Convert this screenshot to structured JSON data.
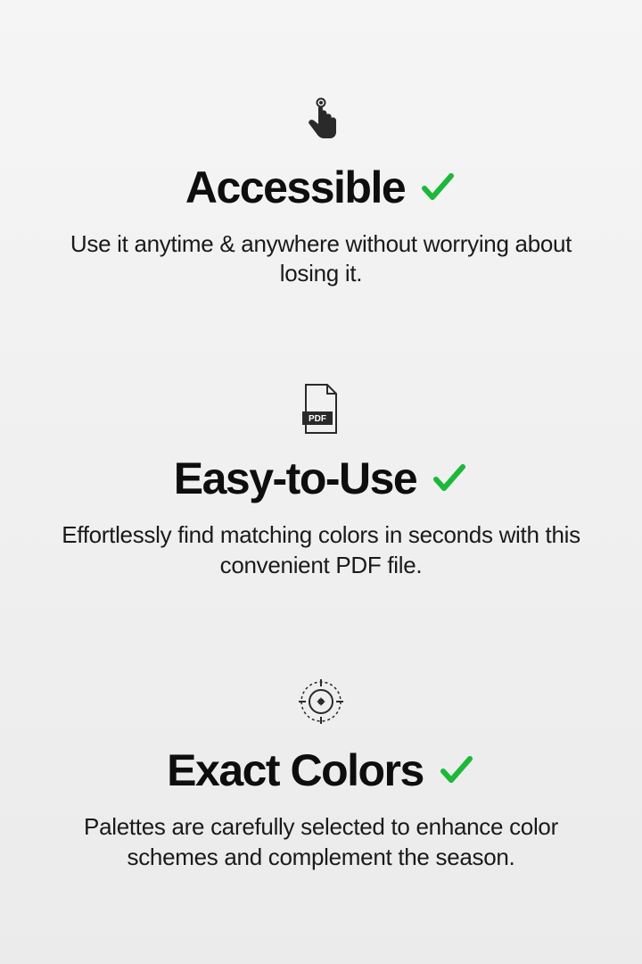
{
  "features": [
    {
      "heading": "Accessible",
      "description": "Use it anytime & anywhere without worrying about losing it."
    },
    {
      "heading": "Easy-to-Use",
      "description": "Effortlessly find matching colors in seconds with this convenient PDF file."
    },
    {
      "heading": "Exact Colors",
      "description": "Palettes are carefully selected to enhance color schemes and complement the season."
    }
  ],
  "pdf_label": "PDF"
}
